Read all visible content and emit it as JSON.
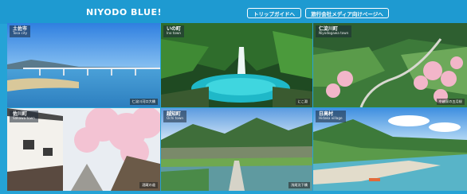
{
  "header": {
    "title": "NIYODO BLUE!",
    "buttons": [
      {
        "label": "トリップガイドへ"
      },
      {
        "label": "旅行会社メディア向けページへ"
      }
    ]
  },
  "tiles": [
    {
      "name_jp": "土佐市",
      "name_en": "Tosa city",
      "caption": "仁淀川河口大橋"
    },
    {
      "name_jp": "いの町",
      "name_en": "Ino town",
      "caption": "にこ淵"
    },
    {
      "name_jp": "仁淀川町",
      "name_en": "Niyodogawa town",
      "caption": "中越家の五月桜"
    },
    {
      "name_jp": "佐川町",
      "name_en": "Sakawa town",
      "caption": "酒蔵の道"
    },
    {
      "name_jp": "越知町",
      "name_en": "Ochi town",
      "caption": "浅尾沈下橋"
    },
    {
      "name_jp": "日高村",
      "name_en": "Hidaka village",
      "caption": ""
    }
  ],
  "colors": {
    "header_bg": "#1e9ad1",
    "page_bg": "#25a3d6",
    "label_bg": "rgba(30,40,55,0.55)"
  }
}
